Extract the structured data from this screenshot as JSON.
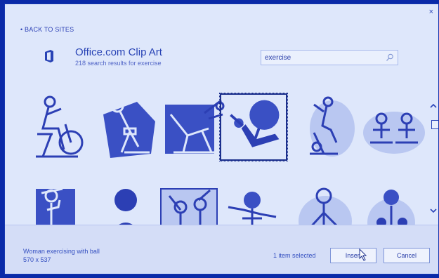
{
  "dialog": {
    "close_label": "×",
    "back_label": "• BACK TO SITES",
    "source": {
      "title": "Office.com Clip Art",
      "subtitle": "218 search results for exercise",
      "icon": "office-logo-icon"
    },
    "search": {
      "value": "exercise",
      "icon": "search-icon"
    },
    "results": [
      {
        "name": "man-on-exercise-bike-clipart",
        "selected": false
      },
      {
        "name": "exercise-bike-clipart",
        "selected": false
      },
      {
        "name": "weight-bench-machine-clipart",
        "selected": false
      },
      {
        "name": "woman-exercising-with-ball-clipart",
        "selected": true
      },
      {
        "name": "woman-on-exercise-bike-clipart",
        "selected": false
      },
      {
        "name": "yoga-couple-clipart",
        "selected": false
      },
      {
        "name": "woman-drinking-water-clipart",
        "selected": false
      },
      {
        "name": "man-lifting-dumbbell-clipart",
        "selected": false
      },
      {
        "name": "couple-stretching-clipart",
        "selected": false
      },
      {
        "name": "child-stretching-clipart",
        "selected": false
      },
      {
        "name": "child-exercising-clipart",
        "selected": false
      },
      {
        "name": "boy-with-dumbbells-clipart",
        "selected": false
      }
    ],
    "footer": {
      "selected_name": "Woman exercising with ball",
      "selected_dims": "570 x 537",
      "selection_count": "1 item selected",
      "insert_label": "Insert",
      "cancel_label": "Cancel"
    },
    "colors": {
      "background": "#0a2aa8",
      "dialog": "#dee7fb",
      "accent": "#2843b5",
      "clipart": "#2c3fb4"
    }
  }
}
